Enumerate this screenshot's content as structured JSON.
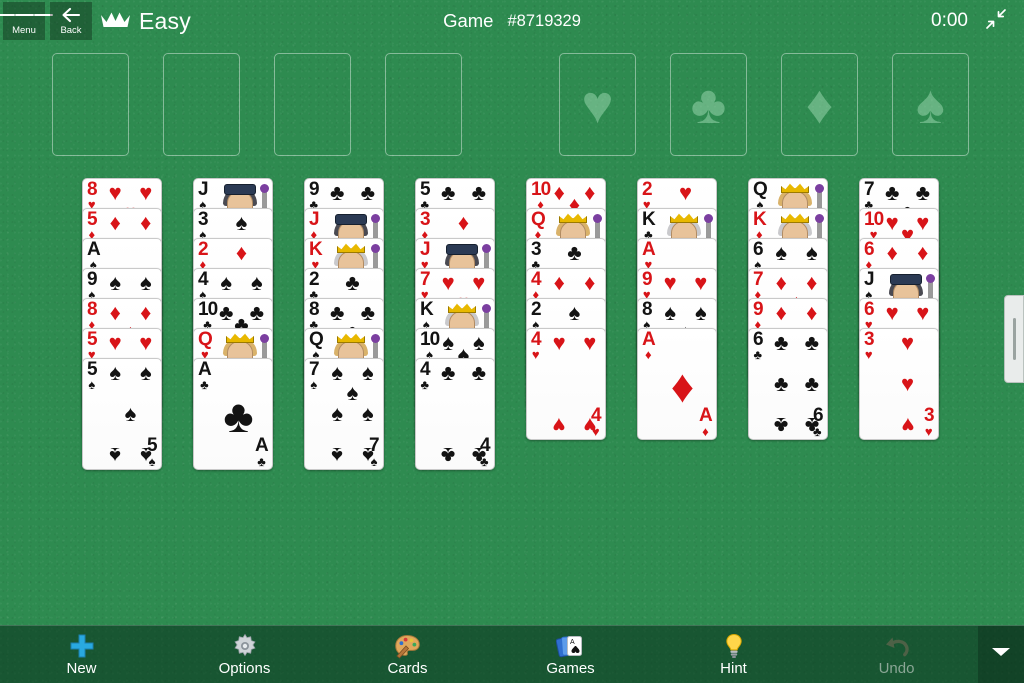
{
  "header": {
    "menu_label": "Menu",
    "menu_icon": "hamburger-icon",
    "back_label": "Back",
    "back_icon": "left-arrow-icon",
    "crown_icon": "crown-icon",
    "difficulty": "Easy",
    "game_word": "Game",
    "game_number": "#8719329",
    "timer": "0:00",
    "collapse_icon": "collapse-arrows-icon"
  },
  "free_cells": [
    {
      "name": "free-cell-1",
      "card": null
    },
    {
      "name": "free-cell-2",
      "card": null
    },
    {
      "name": "free-cell-3",
      "card": null
    },
    {
      "name": "free-cell-4",
      "card": null
    }
  ],
  "foundations": [
    {
      "name": "foundation-hearts",
      "suit": "♥",
      "suit_name": "hearts",
      "card": null
    },
    {
      "name": "foundation-clubs",
      "suit": "♣",
      "suit_name": "clubs",
      "card": null
    },
    {
      "name": "foundation-diamonds",
      "suit": "♦",
      "suit_name": "diamonds",
      "card": null
    },
    {
      "name": "foundation-spades",
      "suit": "♠",
      "suit_name": "spades",
      "card": null
    }
  ],
  "tableau": {
    "columns": [
      {
        "name": "tableau-column-1",
        "cards": [
          {
            "rank": "8",
            "suit": "♥",
            "color": "red",
            "kind": "pip"
          },
          {
            "rank": "5",
            "suit": "♦",
            "color": "red",
            "kind": "pip"
          },
          {
            "rank": "A",
            "suit": "♠",
            "color": "black",
            "kind": "ace"
          },
          {
            "rank": "9",
            "suit": "♠",
            "color": "black",
            "kind": "pip"
          },
          {
            "rank": "8",
            "suit": "♦",
            "color": "red",
            "kind": "pip"
          },
          {
            "rank": "5",
            "suit": "♥",
            "color": "red",
            "kind": "pip"
          },
          {
            "rank": "5",
            "suit": "♠",
            "color": "black",
            "kind": "pip"
          }
        ]
      },
      {
        "name": "tableau-column-2",
        "cards": [
          {
            "rank": "J",
            "suit": "♠",
            "color": "black",
            "kind": "face"
          },
          {
            "rank": "3",
            "suit": "♠",
            "color": "black",
            "kind": "pip"
          },
          {
            "rank": "2",
            "suit": "♦",
            "color": "red",
            "kind": "pip"
          },
          {
            "rank": "4",
            "suit": "♠",
            "color": "black",
            "kind": "pip"
          },
          {
            "rank": "10",
            "suit": "♣",
            "color": "black",
            "kind": "pip"
          },
          {
            "rank": "Q",
            "suit": "♥",
            "color": "red",
            "kind": "face"
          },
          {
            "rank": "A",
            "suit": "♣",
            "color": "black",
            "kind": "ace"
          }
        ]
      },
      {
        "name": "tableau-column-3",
        "cards": [
          {
            "rank": "9",
            "suit": "♣",
            "color": "black",
            "kind": "pip"
          },
          {
            "rank": "J",
            "suit": "♦",
            "color": "red",
            "kind": "face"
          },
          {
            "rank": "K",
            "suit": "♥",
            "color": "red",
            "kind": "face"
          },
          {
            "rank": "2",
            "suit": "♣",
            "color": "black",
            "kind": "pip"
          },
          {
            "rank": "8",
            "suit": "♣",
            "color": "black",
            "kind": "pip"
          },
          {
            "rank": "Q",
            "suit": "♠",
            "color": "black",
            "kind": "face"
          },
          {
            "rank": "7",
            "suit": "♠",
            "color": "black",
            "kind": "pip"
          }
        ]
      },
      {
        "name": "tableau-column-4",
        "cards": [
          {
            "rank": "5",
            "suit": "♣",
            "color": "black",
            "kind": "pip"
          },
          {
            "rank": "3",
            "suit": "♦",
            "color": "red",
            "kind": "pip"
          },
          {
            "rank": "J",
            "suit": "♥",
            "color": "red",
            "kind": "face"
          },
          {
            "rank": "7",
            "suit": "♥",
            "color": "red",
            "kind": "pip"
          },
          {
            "rank": "K",
            "suit": "♠",
            "color": "black",
            "kind": "face"
          },
          {
            "rank": "10",
            "suit": "♠",
            "color": "black",
            "kind": "pip"
          },
          {
            "rank": "4",
            "suit": "♣",
            "color": "black",
            "kind": "pip"
          }
        ]
      },
      {
        "name": "tableau-column-5",
        "cards": [
          {
            "rank": "10",
            "suit": "♦",
            "color": "red",
            "kind": "pip"
          },
          {
            "rank": "Q",
            "suit": "♦",
            "color": "red",
            "kind": "face"
          },
          {
            "rank": "3",
            "suit": "♣",
            "color": "black",
            "kind": "pip"
          },
          {
            "rank": "4",
            "suit": "♦",
            "color": "red",
            "kind": "pip"
          },
          {
            "rank": "2",
            "suit": "♠",
            "color": "black",
            "kind": "pip"
          },
          {
            "rank": "4",
            "suit": "♥",
            "color": "red",
            "kind": "pip"
          }
        ]
      },
      {
        "name": "tableau-column-6",
        "cards": [
          {
            "rank": "2",
            "suit": "♥",
            "color": "red",
            "kind": "pip"
          },
          {
            "rank": "K",
            "suit": "♣",
            "color": "black",
            "kind": "face"
          },
          {
            "rank": "A",
            "suit": "♥",
            "color": "red",
            "kind": "ace"
          },
          {
            "rank": "9",
            "suit": "♥",
            "color": "red",
            "kind": "pip"
          },
          {
            "rank": "8",
            "suit": "♠",
            "color": "black",
            "kind": "pip"
          },
          {
            "rank": "A",
            "suit": "♦",
            "color": "red",
            "kind": "ace"
          }
        ]
      },
      {
        "name": "tableau-column-7",
        "cards": [
          {
            "rank": "Q",
            "suit": "♠",
            "color": "black",
            "kind": "face"
          },
          {
            "rank": "K",
            "suit": "♦",
            "color": "red",
            "kind": "face"
          },
          {
            "rank": "6",
            "suit": "♠",
            "color": "black",
            "kind": "pip"
          },
          {
            "rank": "7",
            "suit": "♦",
            "color": "red",
            "kind": "pip"
          },
          {
            "rank": "9",
            "suit": "♦",
            "color": "red",
            "kind": "pip"
          },
          {
            "rank": "6",
            "suit": "♣",
            "color": "black",
            "kind": "pip"
          }
        ]
      },
      {
        "name": "tableau-column-8",
        "cards": [
          {
            "rank": "7",
            "suit": "♣",
            "color": "black",
            "kind": "pip"
          },
          {
            "rank": "10",
            "suit": "♥",
            "color": "red",
            "kind": "pip"
          },
          {
            "rank": "6",
            "suit": "♦",
            "color": "red",
            "kind": "pip"
          },
          {
            "rank": "J",
            "suit": "♠",
            "color": "black",
            "kind": "face"
          },
          {
            "rank": "6",
            "suit": "♥",
            "color": "red",
            "kind": "pip"
          },
          {
            "rank": "3",
            "suit": "♥",
            "color": "red",
            "kind": "pip"
          }
        ]
      }
    ]
  },
  "toolbar": {
    "items": [
      {
        "name": "toolbar-new",
        "label": "New",
        "icon": "plus-icon",
        "disabled": false
      },
      {
        "name": "toolbar-options",
        "label": "Options",
        "icon": "gear-icon",
        "disabled": false
      },
      {
        "name": "toolbar-cards",
        "label": "Cards",
        "icon": "palette-icon",
        "disabled": false
      },
      {
        "name": "toolbar-games",
        "label": "Games",
        "icon": "cards-icon",
        "disabled": false
      },
      {
        "name": "toolbar-hint",
        "label": "Hint",
        "icon": "lightbulb-icon",
        "disabled": false
      },
      {
        "name": "toolbar-undo",
        "label": "Undo",
        "icon": "undo-arrow-icon",
        "disabled": true
      }
    ],
    "expand_icon": "chevron-down-icon"
  },
  "colors": {
    "felt": "#2e8b50",
    "card_red": "#d81418",
    "card_black": "#131313",
    "accent_blue": "#29a9e0"
  }
}
